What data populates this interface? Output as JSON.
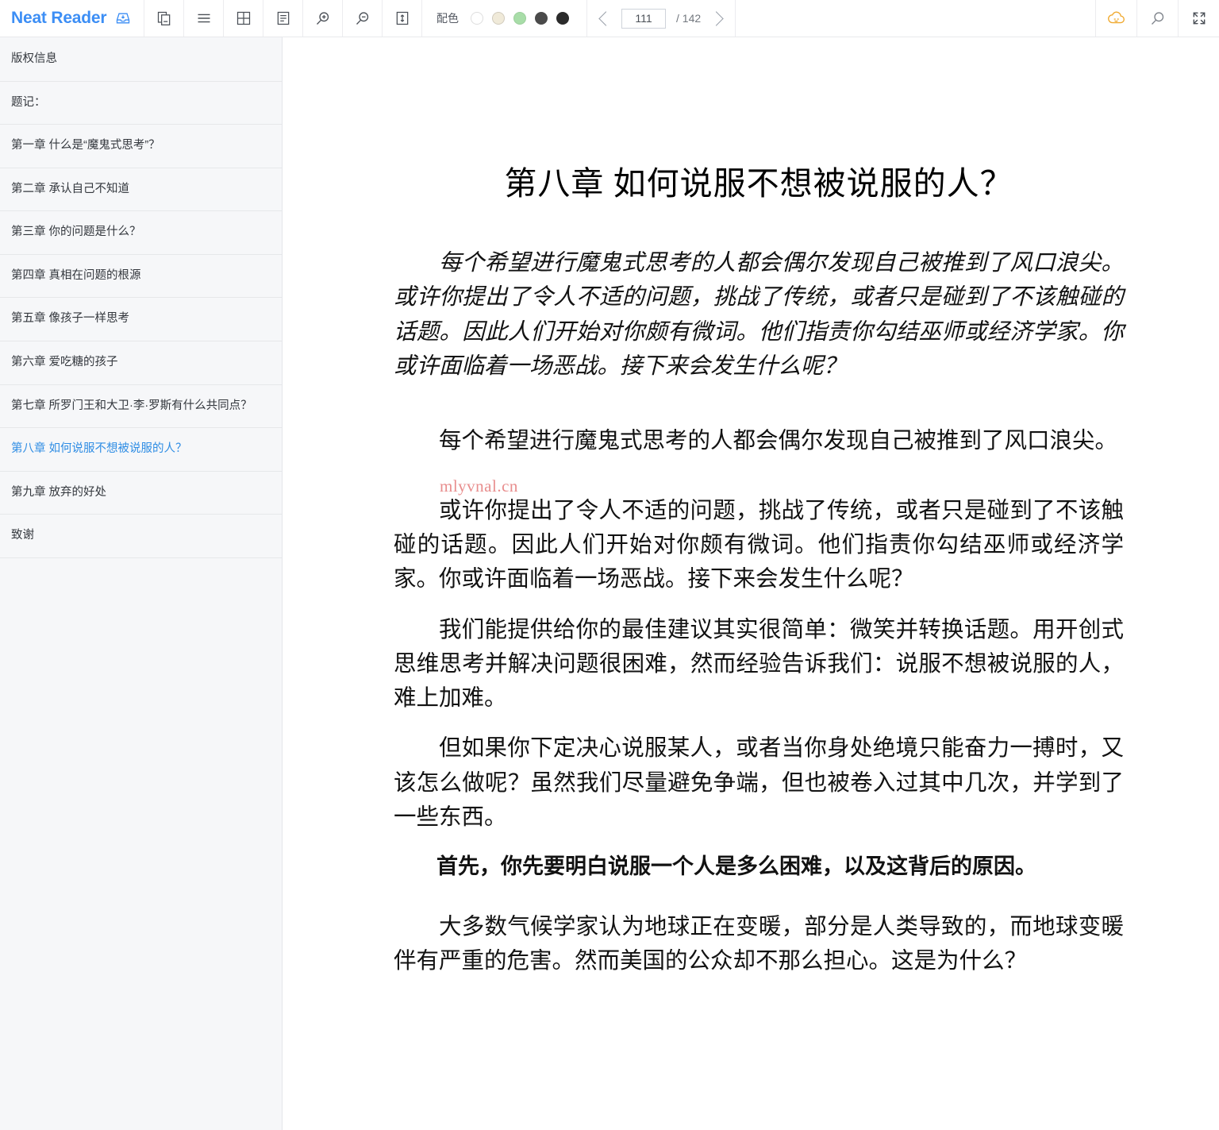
{
  "app": {
    "brand": "Neat Reader",
    "save_icon": "save-to-library-icon"
  },
  "toolbar": {
    "icons": [
      {
        "name": "copy-pages-icon",
        "title": "双页"
      },
      {
        "name": "menu-icon",
        "title": "目录"
      },
      {
        "name": "grid-layout-icon",
        "title": "布局"
      },
      {
        "name": "text-layout-icon",
        "title": "排版"
      },
      {
        "name": "zoom-in-icon",
        "title": "放大"
      },
      {
        "name": "zoom-out-icon",
        "title": "缩小"
      },
      {
        "name": "line-height-icon",
        "title": "行距"
      }
    ],
    "palette": {
      "label": "配色",
      "swatches": [
        {
          "name": "swatch-white",
          "color": "#ffffff",
          "selected": false
        },
        {
          "name": "swatch-cream",
          "color": "#f0ead9",
          "selected": false
        },
        {
          "name": "swatch-green",
          "color": "#a8dda8",
          "selected": false
        },
        {
          "name": "swatch-dark-gray",
          "color": "#4a4a4a",
          "selected": false
        },
        {
          "name": "swatch-black",
          "color": "#2b2b2b",
          "selected": false
        }
      ]
    },
    "pager": {
      "prev_label": "‹",
      "next_label": "›",
      "current_page": "111",
      "total_label": "/ 142",
      "total_pages": 142
    },
    "right_icons": [
      {
        "name": "cloud-sync-icon",
        "color": "#f0a92e"
      },
      {
        "name": "search-icon",
        "color": "#7d828a"
      },
      {
        "name": "fullscreen-icon",
        "color": "#4b5057"
      }
    ]
  },
  "sidebar": {
    "items": [
      {
        "label": "版权信息",
        "active": false
      },
      {
        "label": "题记：",
        "active": false
      },
      {
        "label": "第一章 什么是“魔鬼式思考”？",
        "active": false
      },
      {
        "label": "第二章 承认自己不知道",
        "active": false
      },
      {
        "label": "第三章 你的问题是什么？",
        "active": false
      },
      {
        "label": "第四章 真相在问题的根源",
        "active": false
      },
      {
        "label": "第五章 像孩子一样思考",
        "active": false
      },
      {
        "label": "第六章 爱吃糖的孩子",
        "active": false
      },
      {
        "label": "第七章 所罗门王和大卫·李·罗斯有什么共同点？",
        "active": false
      },
      {
        "label": "第八章 如何说服不想被说服的人？",
        "active": true
      },
      {
        "label": "第九章 放弃的好处",
        "active": false
      },
      {
        "label": "致谢",
        "active": false
      }
    ],
    "active_color": "#2f8de4"
  },
  "reader": {
    "chapter_title": "第八章 如何说服不想被说服的人？",
    "watermark": "mlyvnal.cn",
    "paragraphs": [
      {
        "style": "kai",
        "text": "每个希望进行魔鬼式思考的人都会偶尔发现自己被推到了风口浪尖。或许你提出了令人不适的问题，挑战了传统，或者只是碰到了不该触碰的话题。因此人们开始对你颇有微词。他们指责你勾结巫师或经济学家。你或许面临着一场恶战。接下来会发生什么呢？"
      },
      {
        "style": "gap-after",
        "text": "每个希望进行魔鬼式思考的人都会偶尔发现自己被推到了风口浪尖。"
      },
      {
        "style": "normal",
        "text": "或许你提出了令人不适的问题，挑战了传统，或者只是碰到了不该触碰的话题。因此人们开始对你颇有微词。他们指责你勾结巫师或经济学家。你或许面临着一场恶战。接下来会发生什么呢？"
      },
      {
        "style": "normal",
        "text": "我们能提供给你的最佳建议其实很简单：微笑并转换话题。用开创式思维思考并解决问题很困难，然而经验告诉我们：说服不想被说服的人，难上加难。"
      },
      {
        "style": "normal",
        "text": "但如果你下定决心说服某人，或者当你身处绝境只能奋力一搏时，又该怎么做呢？虽然我们尽量避免争端，但也被卷入过其中几次，并学到了一些东西。"
      },
      {
        "style": "strong",
        "text": "首先，你先要明白说服一个人是多么困难，以及这背后的原因。"
      },
      {
        "style": "normal",
        "text": "大多数气候学家认为地球正在变暖，部分是人类导致的，而地球变暖伴有严重的危害。然而美国的公众却不那么担心。这是为什么？"
      }
    ]
  }
}
